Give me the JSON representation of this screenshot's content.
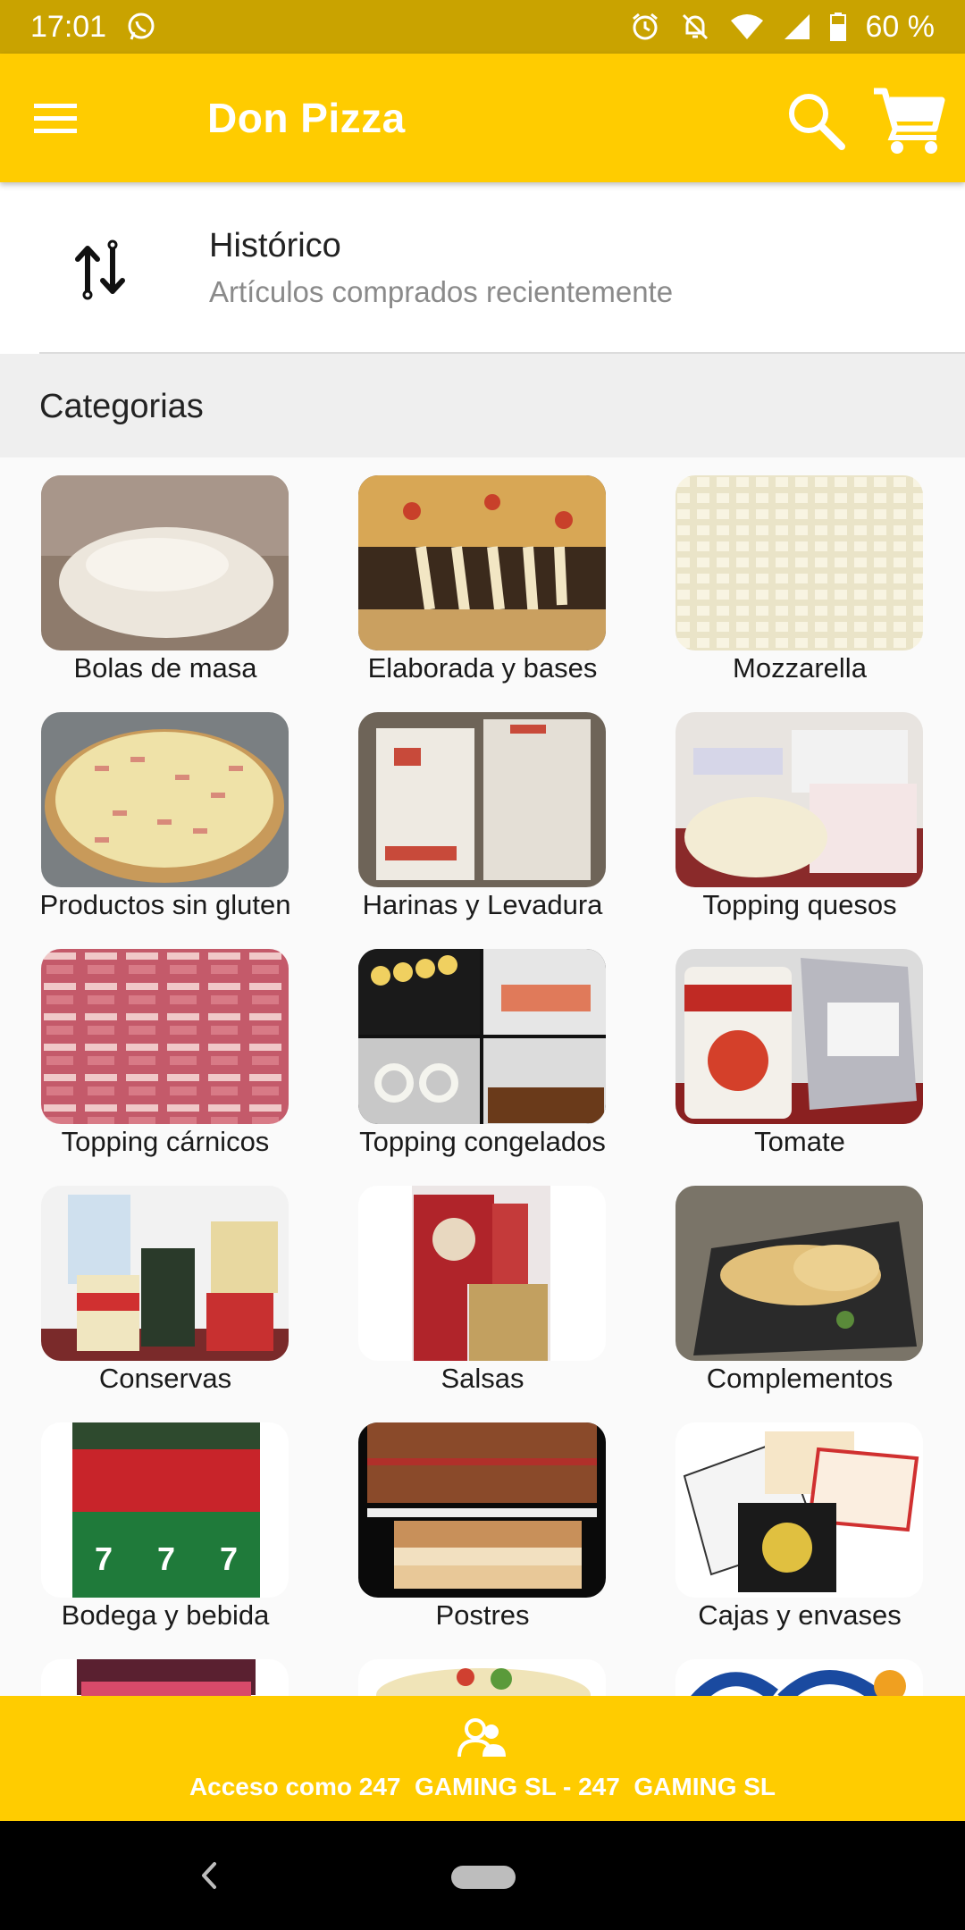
{
  "status_bar": {
    "time": "17:01",
    "battery": "60 %",
    "icons": [
      "whatsapp-icon",
      "alarm-icon",
      "mute-icon",
      "wifi-icon",
      "signal-icon",
      "battery-icon"
    ]
  },
  "app_bar": {
    "title": "Don Pizza",
    "icons": [
      "menu-icon",
      "search-icon",
      "cart-icon"
    ],
    "color": "#ffcc00"
  },
  "historico": {
    "title": "Histórico",
    "subtitle": "Artículos comprados recientemente",
    "icon": "swap-vertical-icon"
  },
  "categories": {
    "header": "Categorias",
    "items": [
      {
        "label": "Bolas de masa"
      },
      {
        "label": "Elaborada y bases"
      },
      {
        "label": "Mozzarella"
      },
      {
        "label": "Productos sin gluten"
      },
      {
        "label": "Harinas y Levadura"
      },
      {
        "label": "Topping quesos"
      },
      {
        "label": "Topping cárnicos"
      },
      {
        "label": "Topping congelados"
      },
      {
        "label": "Tomate"
      },
      {
        "label": "Conservas"
      },
      {
        "label": "Salsas"
      },
      {
        "label": "Complementos"
      },
      {
        "label": "Bodega y bebida"
      },
      {
        "label": "Postres"
      },
      {
        "label": "Cajas y envases"
      },
      {
        "label": ""
      },
      {
        "label": ""
      },
      {
        "label": ""
      }
    ]
  },
  "bottom_bar": {
    "access_text": "Acceso como 247  GAMING SL - 247  GAMING SL",
    "icon": "users-icon"
  },
  "nav_bar": {
    "icons": [
      "back-icon",
      "home-pill"
    ]
  }
}
